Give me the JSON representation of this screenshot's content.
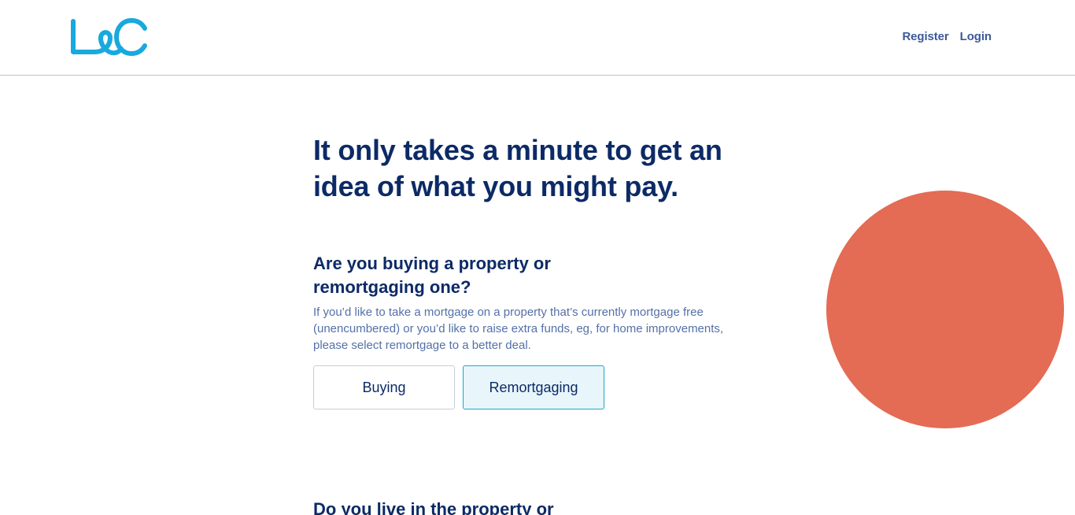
{
  "header": {
    "logo_text": "L&C",
    "nav": {
      "register_label": "Register",
      "login_label": "Login"
    }
  },
  "main": {
    "title": "It only takes a minute to get an idea of what you might pay.",
    "question_1": {
      "label": "Are you buying a property or remortgaging one?",
      "help": "If you’d like to take a mortgage on a property that’s currently mortgage free (unencumbered) or you’d like to raise extra funds, eg, for home improvements, please select remortgage to a better deal.",
      "options": [
        {
          "label": "Buying",
          "selected": false
        },
        {
          "label": "Remortgaging",
          "selected": true
        }
      ]
    },
    "question_2": {
      "label": "Do you live in the property or"
    }
  },
  "colors": {
    "brand_logo": "#18a9de",
    "heading": "#0c2a66",
    "nav_link": "#3d5a99",
    "help_text": "#5470a8",
    "selected_bg": "#e8f6fb",
    "selected_border": "#1aa8c9",
    "decorative_circle": "#e46b54"
  },
  "icons": {
    "logo": "lc-logo-icon"
  }
}
